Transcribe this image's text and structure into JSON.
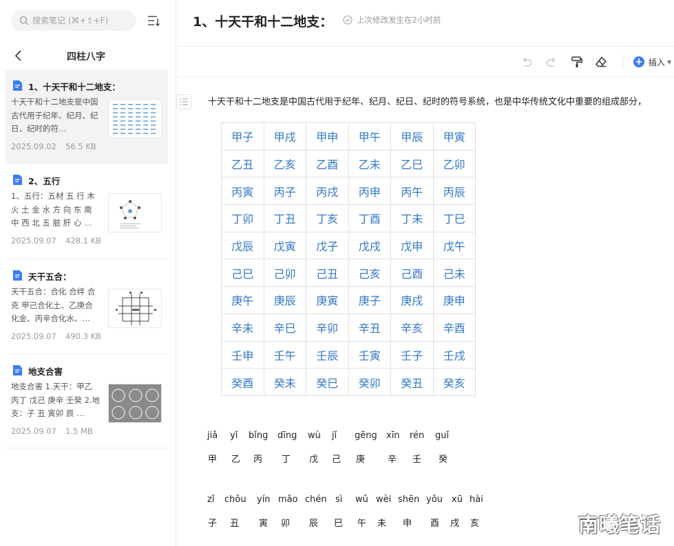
{
  "search": {
    "placeholder": "搜索笔记 (⌘+⇧+F)"
  },
  "folder": {
    "title": "四柱八字"
  },
  "notes": [
    {
      "title": "1、十天干和十二地支：",
      "preview": "十天干和十二地支是中国古代用于纪年、纪月、纪日、纪时的符…",
      "date": "2025.09.02",
      "size": "56.5 KB"
    },
    {
      "title": "2、五行",
      "preview": "1、五行：五材 五 行 木 火 土 金 水 方 向 东 南 中 西 北 五 脏 肝 心 …",
      "date": "2025.09.07",
      "size": "428.1 KB"
    },
    {
      "title": "天干五合：",
      "preview": "天干五合：合化 合绊 合克 甲己合化土、乙庚合化金、丙辛合化水、…",
      "date": "2025.09.07",
      "size": "490.3 KB"
    },
    {
      "title": "地支合害",
      "preview": "地支合害 1.天干：甲乙 丙丁 戊己 庚辛 壬癸 2.地支：子 丑 寅卯 辰 …",
      "date": "2025.09.07",
      "size": "1.5 MB"
    }
  ],
  "doc": {
    "title": "1、十天干和十二地支：",
    "status": "上次修改发生在2小时前",
    "intro": "十天干和十二地支是中国古代用于纪年、纪月、纪日、纪时的符号系统，也是中华传统文化中重要的组成部分，",
    "insert_label": "插入",
    "table": [
      [
        "甲子",
        "甲戌",
        "甲申",
        "甲午",
        "甲辰",
        "甲寅"
      ],
      [
        "乙丑",
        "乙亥",
        "乙酉",
        "乙未",
        "乙巳",
        "乙卯"
      ],
      [
        "丙寅",
        "丙子",
        "丙戌",
        "丙申",
        "丙午",
        "丙辰"
      ],
      [
        "丁卯",
        "丁丑",
        "丁亥",
        "丁酉",
        "丁未",
        "丁巳"
      ],
      [
        "戊辰",
        "戊寅",
        "戊子",
        "戊戌",
        "戊申",
        "戊午"
      ],
      [
        "己巳",
        "己卯",
        "己丑",
        "己亥",
        "己酉",
        "己未"
      ],
      [
        "庚午",
        "庚辰",
        "庚寅",
        "庚子",
        "庚戌",
        "庚申"
      ],
      [
        "辛未",
        "辛巳",
        "辛卯",
        "辛丑",
        "辛亥",
        "辛酉"
      ],
      [
        "壬申",
        "壬午",
        "壬辰",
        "壬寅",
        "壬子",
        "壬戌"
      ],
      [
        "癸酉",
        "癸未",
        "癸巳",
        "癸卯",
        "癸丑",
        "癸亥"
      ]
    ],
    "stems_pinyin": [
      "jiǎ",
      "yǐ",
      "bǐng",
      "dīng",
      "wù",
      "jǐ",
      "gēng",
      "xīn",
      "rén",
      "guǐ"
    ],
    "stems": [
      "甲",
      "乙",
      "丙",
      "丁",
      "戊",
      "己",
      "庚",
      "辛",
      "壬",
      "癸"
    ],
    "branches_pinyin": [
      "zǐ",
      "chǒu",
      "yín",
      "mǎo",
      "chén",
      "sì",
      "wǔ",
      "wèi",
      "shēn",
      "yǒu",
      "xū",
      "hài"
    ],
    "branches": [
      "子",
      "丑",
      "寅",
      "卯",
      "辰",
      "巳",
      "午",
      "未",
      "申",
      "酉",
      "戌",
      "亥"
    ]
  },
  "watermark": "南曦笔话",
  "colors": {
    "accent": "#3b7cf5",
    "table_text": "#2f77c9"
  }
}
